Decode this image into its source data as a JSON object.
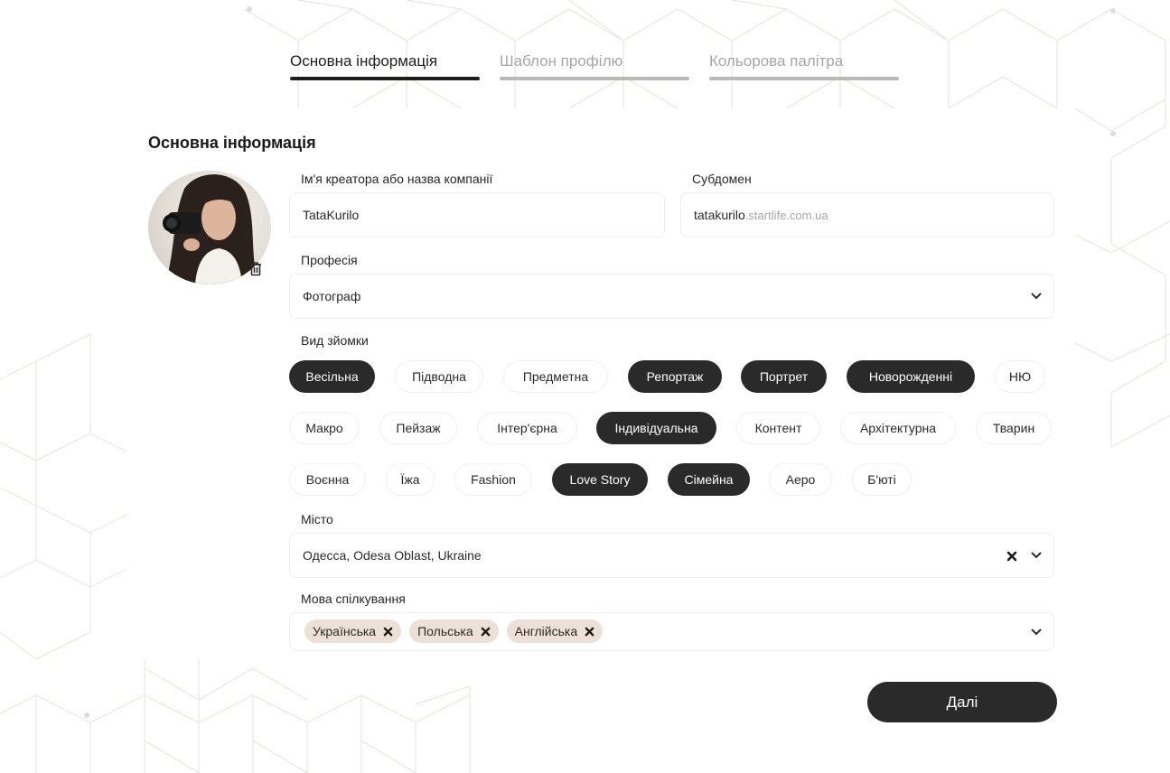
{
  "steps": [
    {
      "label": "Основна інформація",
      "state": "active"
    },
    {
      "label": "Шаблон профілю",
      "state": "inactive"
    },
    {
      "label": "Кольорова палітра",
      "state": "inactive"
    }
  ],
  "section_title": "Основна інформація",
  "avatar": {
    "icon": "profile-photo",
    "delete_icon": "trash-icon"
  },
  "fields": {
    "creator_name": {
      "label": "Ім'я креатора або назва компанії",
      "value": "TataKurilo"
    },
    "subdomain": {
      "label": "Субдомен",
      "value": "tatakurilo",
      "suffix": ".startlife.com.ua"
    },
    "profession": {
      "label": "Професія",
      "value": "Фотограф"
    },
    "city": {
      "label": "Місто",
      "value": "Одесса, Odesa Oblast, Ukraine"
    },
    "language": {
      "label": "Мова спілкування",
      "tags": [
        "Українська",
        "Польська",
        "Англійська"
      ]
    }
  },
  "shoot_types": {
    "label": "Вид зйомки",
    "rows": [
      [
        {
          "label": "Весільна",
          "selected": true
        },
        {
          "label": "Підводна",
          "selected": false
        },
        {
          "label": "Предметна",
          "selected": false
        },
        {
          "label": "Репортаж",
          "selected": true
        },
        {
          "label": "Портрет",
          "selected": true
        },
        {
          "label": "Новорожденні",
          "selected": true
        },
        {
          "label": "НЮ",
          "selected": false
        }
      ],
      [
        {
          "label": "Макро",
          "selected": false
        },
        {
          "label": "Пейзаж",
          "selected": false
        },
        {
          "label": "Інтер'єрна",
          "selected": false
        },
        {
          "label": "Індивідуальна",
          "selected": true
        },
        {
          "label": "Контент",
          "selected": false
        },
        {
          "label": "Архітектурна",
          "selected": false
        },
        {
          "label": "Тварин",
          "selected": false
        }
      ],
      [
        {
          "label": "Воєнна",
          "selected": false
        },
        {
          "label": "Їжа",
          "selected": false
        },
        {
          "label": "Fashion",
          "selected": false
        },
        {
          "label": "Love Story",
          "selected": true
        },
        {
          "label": "Сімейна",
          "selected": true
        },
        {
          "label": "Аеро",
          "selected": false
        },
        {
          "label": "Б'юті",
          "selected": false
        }
      ]
    ]
  },
  "next_button": "Далі",
  "colors": {
    "dark": "#2a2a2a",
    "tag_bg": "#ece0d8",
    "muted": "#a7a7a7",
    "pattern": "#e9e4df"
  }
}
